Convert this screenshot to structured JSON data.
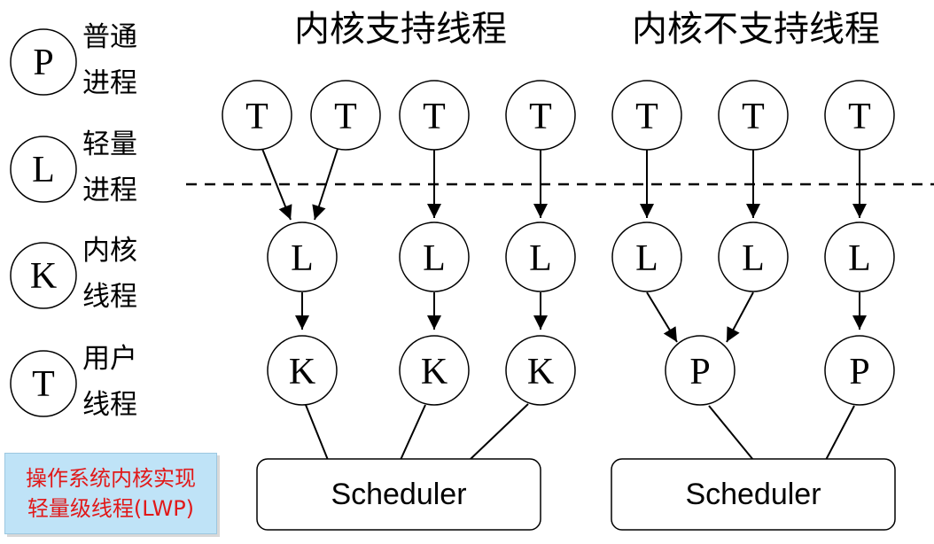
{
  "titles": {
    "left": "内核支持线程",
    "right": "内核不支持线程"
  },
  "legend": [
    {
      "symbol": "P",
      "line1": "普通",
      "line2": "进程"
    },
    {
      "symbol": "L",
      "line1": "轻量",
      "line2": "进程"
    },
    {
      "symbol": "K",
      "line1": "内核",
      "line2": "线程"
    },
    {
      "symbol": "T",
      "line1": "用户",
      "line2": "线程"
    }
  ],
  "nodes": {
    "t": [
      "T",
      "T",
      "T",
      "T",
      "T",
      "T",
      "T"
    ],
    "l": [
      "L",
      "L",
      "L",
      "L",
      "L",
      "L"
    ],
    "k": [
      "K",
      "K",
      "K"
    ],
    "p": [
      "P",
      "P"
    ]
  },
  "schedulers": {
    "left": "Scheduler",
    "right": "Scheduler"
  },
  "note": {
    "line1": "操作系统内核实现",
    "line2": "轻量级线程(LWP)"
  },
  "colors": {
    "note_bg": "#bfe3f7",
    "note_text": "#e11919"
  }
}
